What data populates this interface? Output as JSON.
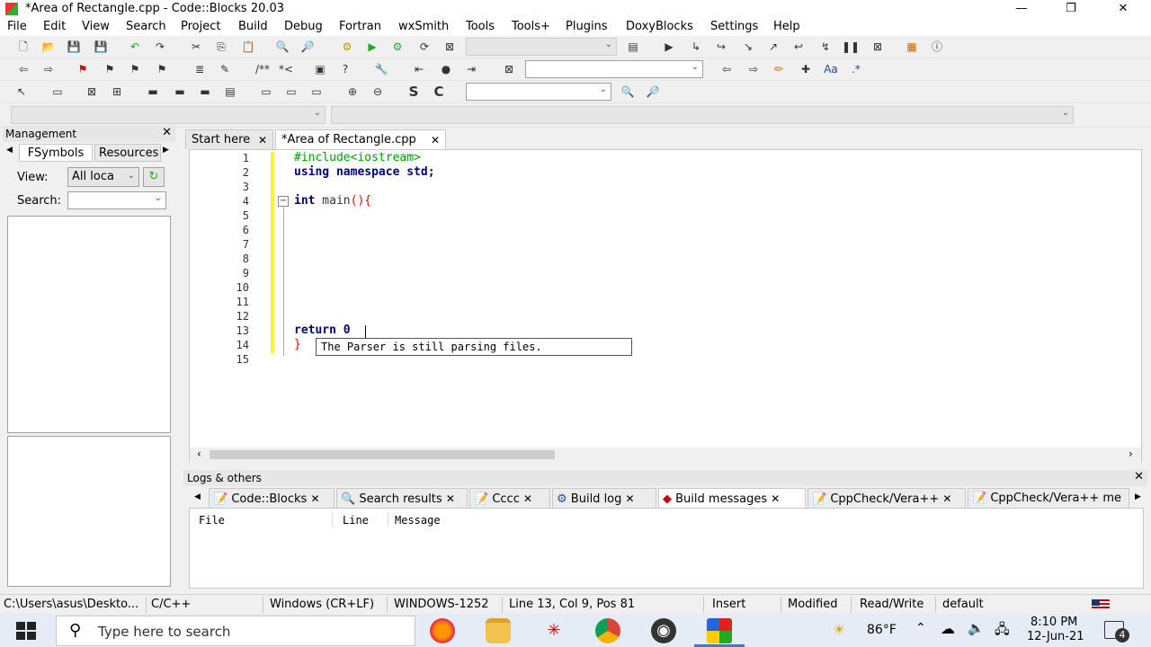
{
  "window": {
    "title": "*Area of Rectangle.cpp - Code::Blocks 20.03",
    "minimize": "—",
    "maximize": "❐",
    "close": "✕"
  },
  "menu": [
    "File",
    "Edit",
    "View",
    "Search",
    "Project",
    "Build",
    "Debug",
    "Fortran",
    "wxSmith",
    "Tools",
    "Tools+",
    "Plugins",
    "DoxyBlocks",
    "Settings",
    "Help"
  ],
  "management": {
    "title": "Management",
    "close": "✕",
    "tabs": [
      "FSymbols",
      "Resources"
    ],
    "view_label": "View:",
    "view_value": "All loca",
    "search_label": "Search:",
    "search_value": ""
  },
  "editor": {
    "tabs": [
      {
        "label": "Start here",
        "close": "✕"
      },
      {
        "label": "*Area of Rectangle.cpp",
        "close": "✕"
      }
    ],
    "lines": [
      {
        "n": "1",
        "text": "#include<iostream>"
      },
      {
        "n": "2",
        "text": "using namespace std;"
      },
      {
        "n": "3",
        "text": ""
      },
      {
        "n": "4",
        "text": "int main(){"
      },
      {
        "n": "5",
        "text": ""
      },
      {
        "n": "6",
        "text": ""
      },
      {
        "n": "7",
        "text": ""
      },
      {
        "n": "8",
        "text": ""
      },
      {
        "n": "9",
        "text": ""
      },
      {
        "n": "10",
        "text": ""
      },
      {
        "n": "11",
        "text": ""
      },
      {
        "n": "12",
        "text": ""
      },
      {
        "n": "13",
        "text": "return 0"
      },
      {
        "n": "14",
        "text": "}"
      },
      {
        "n": "15",
        "text": ""
      }
    ],
    "calltip": "The Parser is still parsing files."
  },
  "logs": {
    "title": "Logs & others",
    "close": "✕",
    "tabs": [
      "Code::Blocks",
      "Search results",
      "Cccc",
      "Build log",
      "Build messages",
      "CppCheck/Vera++",
      "CppCheck/Vera++ me"
    ],
    "tab_close": "✕",
    "columns": [
      "File",
      "Line",
      "Message"
    ]
  },
  "status": {
    "path": "C:\\Users\\asus\\Deskto...",
    "language": "C/C++",
    "eol": "Windows (CR+LF)",
    "encoding": "WINDOWS-1252",
    "position": "Line 13, Col 9, Pos 81",
    "mode": "Insert",
    "modified": "Modified",
    "access": "Read/Write",
    "profile": "default"
  },
  "taskbar": {
    "search_placeholder": "Type here to search",
    "weather": "86°F",
    "time": "8:10 PM",
    "date": "12-Jun-21",
    "notifications": "4"
  },
  "colors": {
    "keyword": "#00007f",
    "preprocessor": "#00a000",
    "brace": "#ff0000",
    "taskbar": "#e6ecf5",
    "accent": "#3a7bd5"
  }
}
